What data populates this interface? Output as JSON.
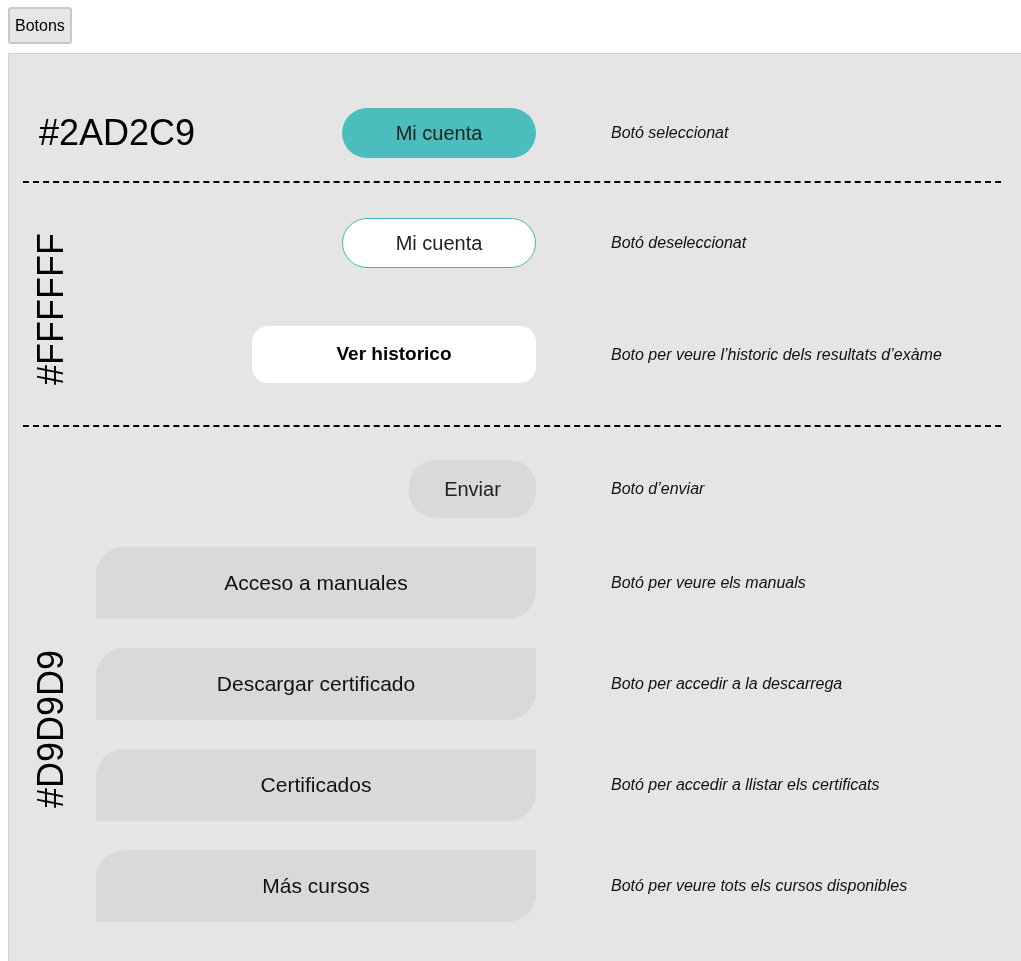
{
  "top_button": "Botons",
  "sections": [
    {
      "color_label": "#2AD2C9",
      "kind": "horizontal",
      "rows": [
        {
          "button": "Mi cuenta",
          "kind": "pill",
          "selected": true,
          "description": "Botó seleccionat"
        }
      ]
    },
    {
      "color_label": "#FFFFFF",
      "kind": "vertical",
      "rows": [
        {
          "button": "Mi cuenta",
          "kind": "pill",
          "selected": false,
          "description": "Botó deseleccionat"
        },
        {
          "button": "Ver historico",
          "kind": "white-bold",
          "description": "Boto per veure l’historic dels resultats d’exàme"
        }
      ]
    },
    {
      "color_label": "#D9D9D9",
      "kind": "vertical",
      "rows": [
        {
          "button": "Enviar",
          "kind": "grey-pill",
          "description": "Boto d’enviar"
        },
        {
          "button": "Acceso a manuales",
          "kind": "grey-tab",
          "description": "Botó per veure els manuals"
        },
        {
          "button": "Descargar certificado",
          "kind": "grey-tab",
          "description": "Boto per accedir a la descarrega"
        },
        {
          "button": "Certificados",
          "kind": "grey-tab",
          "description": "Botó per accedir a llistar els certificats"
        },
        {
          "button": "Más cursos",
          "kind": "grey-tab",
          "description": "Botó per veure tots els cursos disponibles"
        }
      ]
    }
  ]
}
